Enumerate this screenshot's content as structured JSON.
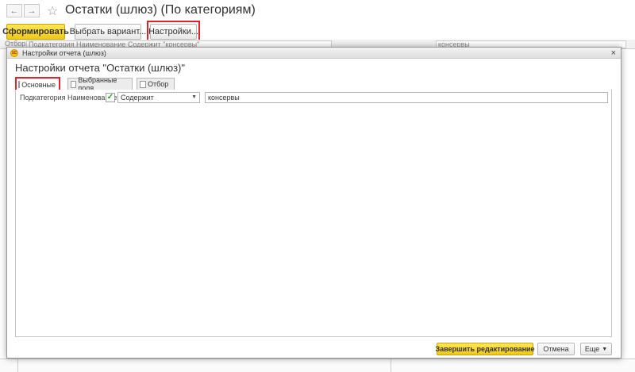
{
  "window": {
    "title": "Остатки (шлюз) (По категориям)",
    "back_symbol": "←",
    "forward_symbol": "→",
    "favorite_symbol": "☆"
  },
  "toolbar": {
    "generate_label": "Сформировать",
    "choose_variant_label": "Выбрать вариант...",
    "settings_label": "Настройки..."
  },
  "filter_strip": {
    "label": "Отбор:",
    "value": "Подкатегория Наименование Содержит \"консервы\"",
    "right_value": "консервы"
  },
  "dialog": {
    "caption": "Настройки отчета (шлюз)",
    "heading": "Настройки отчета \"Остатки (шлюз)\"",
    "app_badge": "1С",
    "close_symbol": "×",
    "tabs": [
      {
        "label": "Основные",
        "active": true
      },
      {
        "label": "Выбранные поля",
        "active": false
      },
      {
        "label": "Отбор",
        "active": false
      }
    ],
    "filter_row": {
      "label": "Подкатегория Наименование",
      "checked": true,
      "check_symbol": "✓",
      "condition": "Содержит",
      "value": "консервы"
    },
    "footer": {
      "finish_label": "Завершить редактирование",
      "cancel_label": "Отмена",
      "more_label": "Еще"
    }
  },
  "colors": {
    "accent_yellow": "#f0c814",
    "highlight_red": "#e0222e",
    "check_green": "#2a9a2a"
  }
}
